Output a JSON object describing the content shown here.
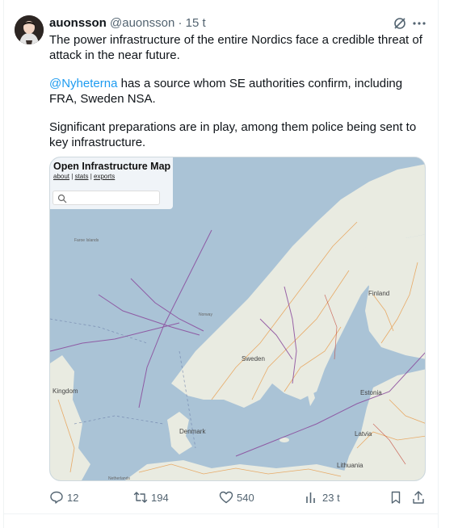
{
  "tweet": {
    "display_name": "auonsson",
    "handle": "@auonsson",
    "separator": "·",
    "time": "15 t",
    "paragraphs": [
      {
        "text": "The power infrastructure of the entire Nordics face a credible threat of attack in the near future."
      },
      {
        "mention": "@Nyheterna",
        "text": " has a source whom SE authorities confirm, including FRA, Sweden NSA."
      },
      {
        "text": "Significant preparations are in play, among them police being sent to key infrastructure."
      }
    ]
  },
  "map": {
    "title": "Open Infrastructure Map",
    "link_about": "about",
    "link_stats": "stats",
    "link_exports": "exports",
    "link_sep": "|",
    "labels": {
      "faroe": "Faroe Islands",
      "norway": "Norway",
      "sweden": "Sweden",
      "finland": "Finland",
      "kingdom": "Kingdom",
      "estonia": "Estonia",
      "denmark": "Denmark",
      "latvia": "Latvia",
      "lithuania": "Lithuania",
      "netherlands": "Netherlands"
    }
  },
  "actions": {
    "replies": "12",
    "reposts": "194",
    "likes": "540",
    "views": "23 t"
  },
  "colors": {
    "accent": "#1d9bf0",
    "text": "#0f1419",
    "muted": "#536471",
    "sea": "#aac3d6",
    "land": "#e9ebe1"
  }
}
